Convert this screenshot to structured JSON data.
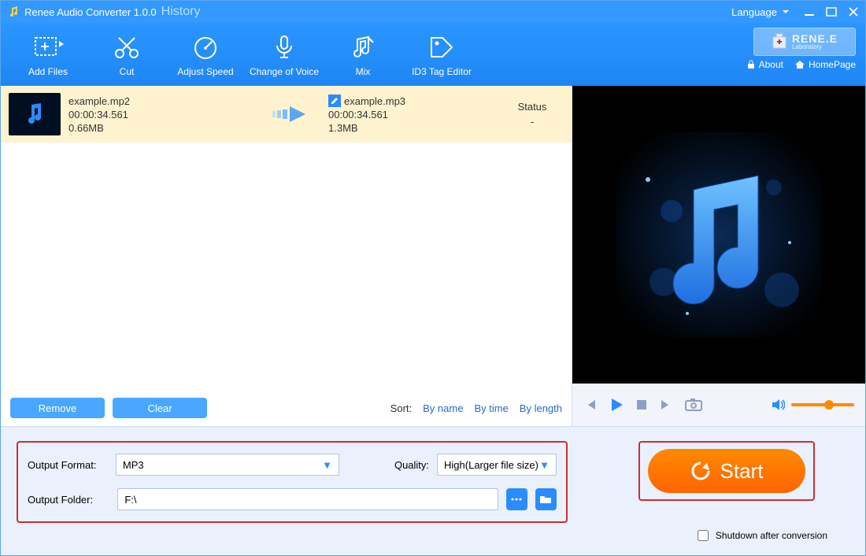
{
  "title": "Renee Audio Converter 1.0.0",
  "history_label": "History",
  "language_label": "Language",
  "brand": "RENE.E",
  "brand_sub": "Laboratory",
  "links": {
    "about": "About",
    "homepage": "HomePage"
  },
  "toolbar": {
    "add_files": "Add Files",
    "cut": "Cut",
    "adjust_speed": "Adjust Speed",
    "change_voice": "Change of Voice",
    "mix": "Mix",
    "id3": "ID3 Tag Editor"
  },
  "file": {
    "in_name": "example.mp2",
    "in_dur": "00:00:34.561",
    "in_size": "0.66MB",
    "out_name": "example.mp3",
    "out_dur": "00:00:34.561",
    "out_size": "1.3MB",
    "status_header": "Status",
    "status_value": "-"
  },
  "buttons": {
    "remove": "Remove",
    "clear": "Clear"
  },
  "sort": {
    "label": "Sort:",
    "by_name": "By name",
    "by_time": "By time",
    "by_length": "By length"
  },
  "settings": {
    "format_label": "Output Format:",
    "format_value": "MP3",
    "quality_label": "Quality:",
    "quality_value": "High(Larger file size)",
    "folder_label": "Output Folder:",
    "folder_value": "F:\\"
  },
  "start_label": "Start",
  "shutdown_label": "Shutdown after conversion"
}
